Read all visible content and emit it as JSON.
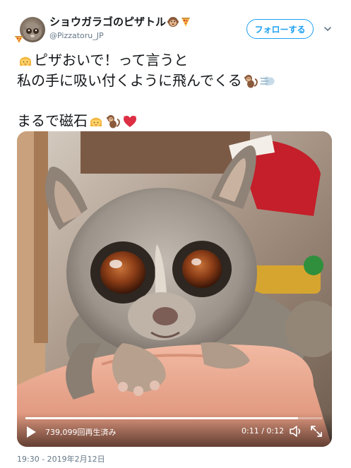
{
  "author": {
    "name": "ショウガラゴのピザトル",
    "handle": "@Pizzatoru_JP",
    "name_emojis": [
      "monkey-face-icon",
      "pizza-icon"
    ]
  },
  "follow_button": {
    "label": "フォローする"
  },
  "tweet": {
    "line1": "ピザおいで！って言うと",
    "line2": "私の手に吸い付くように飛んでくる",
    "line3": "まるで磁石",
    "emojis": {
      "line1_prefix": "woman-icon",
      "line2_suffix": [
        "monkey-icon",
        "dash-icon"
      ],
      "line3_suffix": [
        "woman-icon",
        "monkey-icon",
        "heart-icon"
      ]
    }
  },
  "video": {
    "views": "739,099回再生済み",
    "time": "0:11 / 0:12",
    "progress": 0.92,
    "colors": {
      "accent": "#1da1f2",
      "background": "#ffffff"
    }
  },
  "timestamp": "19:30 - 2019年2月12日"
}
